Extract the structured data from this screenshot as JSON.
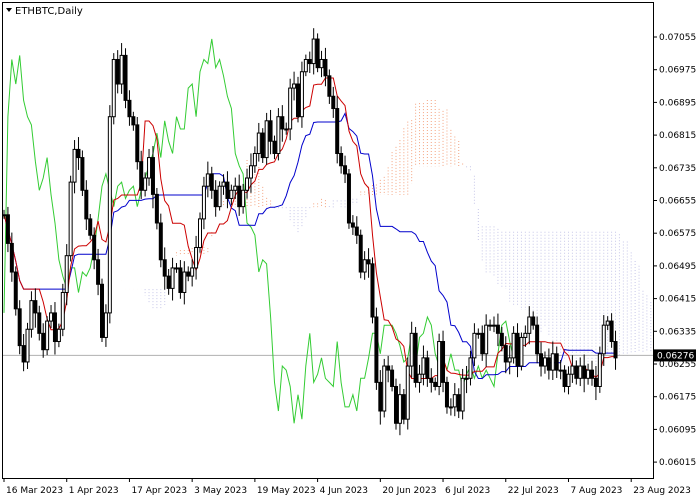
{
  "title": {
    "symbol": "ETHBTC",
    "timeframe": "Daily",
    "text": "ETHBTC,Daily"
  },
  "colors": {
    "background": "#ffffff",
    "candle": "#000000",
    "tenkan": "#cc0000",
    "kijun": "#0000cc",
    "chikou": "#33cc33",
    "cloud_bull": "#f4a582",
    "cloud_bear": "#c7c7e8",
    "price_line": "#b0b0b0",
    "price_tag": "#000000"
  },
  "chart_data": {
    "type": "candlestick",
    "indicator": "ichimoku",
    "ylim": [
      0.06015,
      0.07095
    ],
    "y_ticks": [
      "0.07055",
      "0.06975",
      "0.06895",
      "0.06815",
      "0.06735",
      "0.06655",
      "0.06575",
      "0.06495",
      "0.06415",
      "0.06335",
      "0.06255",
      "0.06175",
      "0.06095",
      "0.06015"
    ],
    "x_labels": [
      {
        "label": "16 Mar 2023",
        "index": 0
      },
      {
        "label": "1 Apr 2023",
        "index": 16
      },
      {
        "label": "17 Apr 2023",
        "index": 32
      },
      {
        "label": "3 May 2023",
        "index": 48
      },
      {
        "label": "19 May 2023",
        "index": 64
      },
      {
        "label": "4 Jun 2023",
        "index": 80
      },
      {
        "label": "20 Jun 2023",
        "index": 96
      },
      {
        "label": "6 Jul 2023",
        "index": 112
      },
      {
        "label": "22 Jul 2023",
        "index": 128
      },
      {
        "label": "7 Aug 2023",
        "index": 144
      },
      {
        "label": "23 Aug 2023",
        "index": 160
      }
    ],
    "current_price": "0.06276",
    "close": [
      0.0662,
      0.0655,
      0.0648,
      0.0639,
      0.063,
      0.0626,
      0.0634,
      0.0641,
      0.0638,
      0.0633,
      0.0629,
      0.0636,
      0.0638,
      0.0631,
      0.0634,
      0.0643,
      0.0652,
      0.067,
      0.0678,
      0.0676,
      0.0668,
      0.0661,
      0.0657,
      0.0651,
      0.0645,
      0.0632,
      0.0638,
      0.0686,
      0.07,
      0.0694,
      0.0701,
      0.069,
      0.0686,
      0.0684,
      0.0675,
      0.0668,
      0.0671,
      0.0676,
      0.0667,
      0.066,
      0.0651,
      0.0647,
      0.0644,
      0.0649,
      0.0649,
      0.0643,
      0.0648,
      0.0647,
      0.0649,
      0.0654,
      0.0661,
      0.0669,
      0.0672,
      0.0668,
      0.0664,
      0.0669,
      0.067,
      0.0666,
      0.0668,
      0.0669,
      0.0664,
      0.0668,
      0.0671,
      0.0674,
      0.0677,
      0.0682,
      0.0676,
      0.0685,
      0.068,
      0.0677,
      0.0686,
      0.0683,
      0.0683,
      0.0693,
      0.0694,
      0.0686,
      0.0697,
      0.07,
      0.0699,
      0.0705,
      0.0698,
      0.07,
      0.0696,
      0.0691,
      0.0688,
      0.0677,
      0.0674,
      0.0672,
      0.066,
      0.0659,
      0.0657,
      0.0648,
      0.0651,
      0.065,
      0.0637,
      0.0621,
      0.0614,
      0.0625,
      0.0624,
      0.062,
      0.0611,
      0.0618,
      0.0612,
      0.0625,
      0.0633,
      0.0621,
      0.0623,
      0.0627,
      0.0622,
      0.0621,
      0.062,
      0.0631,
      0.0621,
      0.0615,
      0.0615,
      0.0618,
      0.0614,
      0.0622,
      0.0622,
      0.0627,
      0.0633,
      0.0633,
      0.0628,
      0.0635,
      0.0635,
      0.0635,
      0.0633,
      0.063,
      0.0626,
      0.0627,
      0.0633,
      0.0625,
      0.0632,
      0.0633,
      0.0637,
      0.0635,
      0.0628,
      0.0625,
      0.0627,
      0.0624,
      0.0628,
      0.0624,
      0.0624,
      0.062,
      0.0623,
      0.0625,
      0.0622,
      0.0625,
      0.0622,
      0.0624,
      0.0622,
      0.062,
      0.0628,
      0.0635,
      0.0636,
      0.0631,
      0.0627
    ],
    "series": [
      {
        "name": "Tenkan-sen",
        "color_key": "tenkan"
      },
      {
        "name": "Kijun-sen",
        "color_key": "kijun"
      },
      {
        "name": "Chikou Span",
        "color_key": "chikou"
      },
      {
        "name": "Senkou Span A",
        "color_key": "cloud_bull"
      },
      {
        "name": "Senkou Span B",
        "color_key": "cloud_bear"
      }
    ]
  }
}
